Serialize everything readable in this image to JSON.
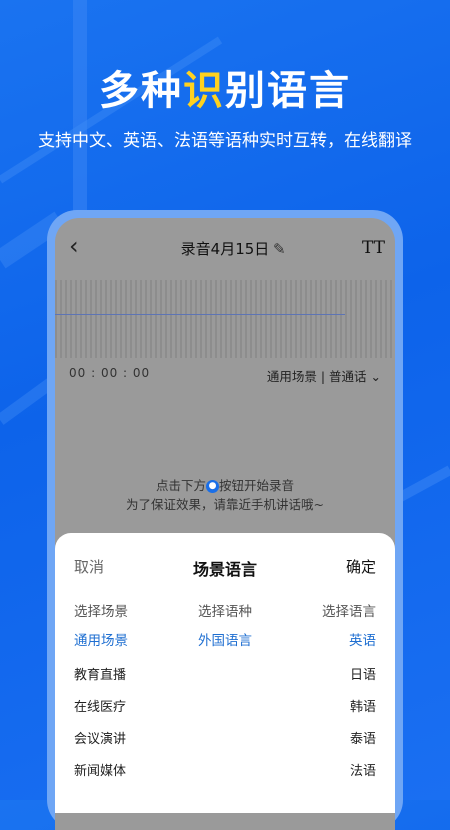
{
  "promo": {
    "title_part1": "多种",
    "title_highlight": "识",
    "title_part2": "别语言",
    "subtitle": "支持中文、英语、法语等语种实时互转，在线翻译"
  },
  "recording": {
    "back_icon": "chevron-left-icon",
    "title": "录音4月15日",
    "edit_icon": "pencil-icon",
    "text_size_label": "TT",
    "timer": "00 :  00 :  00",
    "scene_selector": "通用场景 | 普通话",
    "hint_before": "点击下方",
    "hint_after": "按钮开始录音",
    "hint_line2": "为了保证效果，请靠近手机讲话哦~"
  },
  "sheet": {
    "cancel": "取消",
    "title": "场景语言",
    "confirm": "确定",
    "columns": [
      {
        "header": "选择场景",
        "selected": "通用场景",
        "items": [
          "教育直播",
          "在线医疗",
          "会议演讲",
          "新闻媒体"
        ]
      },
      {
        "header": "选择语种",
        "selected": "外国语言",
        "items": []
      },
      {
        "header": "选择语言",
        "selected": "英语",
        "items": [
          "日语",
          "韩语",
          "泰语",
          "法语"
        ]
      }
    ]
  },
  "colors": {
    "brand_blue": "#1a6ff2",
    "highlight_yellow": "#ffd21f",
    "selected_blue": "#1f6fd1"
  }
}
